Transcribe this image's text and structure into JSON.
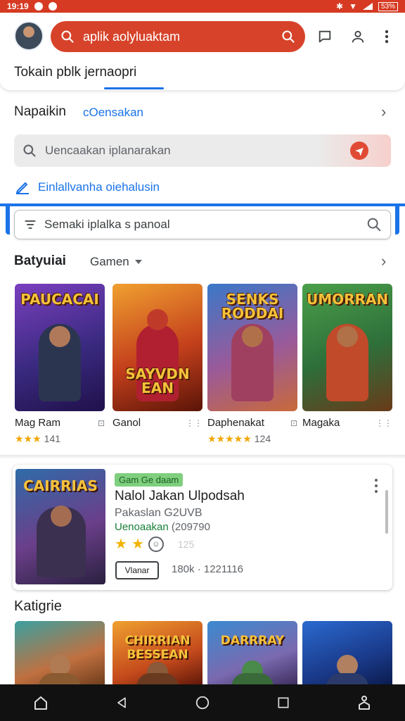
{
  "status_bar": {
    "time": "19:19",
    "battery": "53%"
  },
  "header": {
    "search_text": "aplik aolyluaktam",
    "tab_title": "Tokain pblk jernaopri"
  },
  "section2": {
    "title": "Napaikin",
    "link": "cOensakan",
    "search_text": "Uencaakan iplanarakan",
    "link_row_text": "Einlallvanha oiehalusin"
  },
  "search2": {
    "text": "Semaki iplalka s panoal"
  },
  "games_row": {
    "title": "Batyuiai",
    "filter": "Gamen",
    "items": [
      {
        "logo": "PAUCACAI",
        "name": "Mag Ram",
        "stars": "★★★",
        "rating": "141"
      },
      {
        "logo": "SAYVDN EAN",
        "name": "Ganol",
        "stars": "",
        "rating": ""
      },
      {
        "logo": "SENKS RODDAI",
        "name": "Daphenakat",
        "stars": "★★★★★",
        "rating": "124"
      },
      {
        "logo": "UMORRAN",
        "name": "Magaka",
        "stars": "",
        "rating": ""
      }
    ]
  },
  "featured": {
    "logo": "CAIRRIAS",
    "badge": "Gam Ge daam",
    "title": "Nalol Jakan Ulpodsah",
    "subtitle": "Pakaslan G2UVB",
    "line3_green": "Uenoaakan",
    "line3_gray": "(209790",
    "faint": "125",
    "button": "Vlanar",
    "stats": "180k · 1221116"
  },
  "categories": {
    "title": "Katigrie",
    "items": [
      {
        "logo": ""
      },
      {
        "logo": "CHIRRIAN BESSEAN"
      },
      {
        "logo": "DARRRAY"
      },
      {
        "logo": ""
      }
    ]
  },
  "colors": {
    "accent_red": "#d7432a",
    "accent_blue": "#1a73e8",
    "star": "#f2a600"
  },
  "icons": {
    "search": "search-icon",
    "chat": "chat-icon",
    "profile": "profile-icon",
    "menu": "menu-dots-icon",
    "chevron": "chevron-right-icon"
  }
}
